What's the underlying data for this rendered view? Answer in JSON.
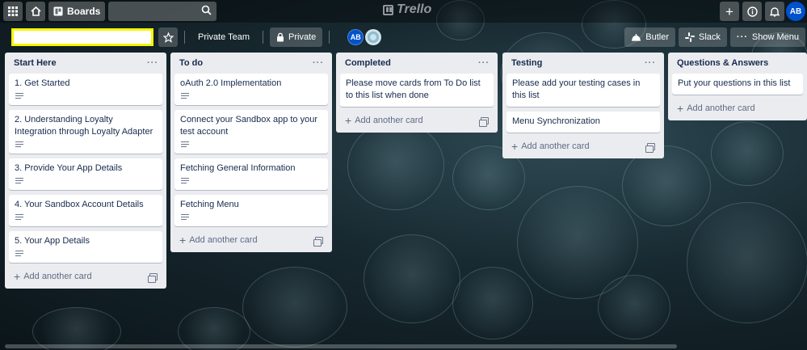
{
  "topbar": {
    "boards_label": "Boards",
    "logo_text": "Trello",
    "avatar_initials": "AB"
  },
  "board": {
    "name": "",
    "team_label": "Private Team",
    "visibility_label": "Private",
    "member_initials": "AB",
    "butler_label": "Butler",
    "slack_label": "Slack",
    "show_menu_label": "Show Menu"
  },
  "add_card_label": "Add another card",
  "lists": [
    {
      "title": "Start Here",
      "cards": [
        {
          "title": "1. Get Started",
          "has_description": true
        },
        {
          "title": "2. Understanding Loyalty Integration through Loyalty Adapter",
          "has_description": true
        },
        {
          "title": "3. Provide Your App Details",
          "has_description": true
        },
        {
          "title": "4. Your Sandbox Account Details",
          "has_description": true
        },
        {
          "title": "5. Your App Details",
          "has_description": true
        }
      ]
    },
    {
      "title": "To do",
      "cards": [
        {
          "title": "oAuth 2.0 Implementation",
          "has_description": true
        },
        {
          "title": "Connect your Sandbox app to your test account",
          "has_description": true
        },
        {
          "title": "Fetching General Information",
          "has_description": true
        },
        {
          "title": "Fetching Menu",
          "has_description": true
        }
      ]
    },
    {
      "title": "Completed",
      "cards": [
        {
          "title": "Please move cards from To Do list to this list when done",
          "has_description": false
        }
      ]
    },
    {
      "title": "Testing",
      "cards": [
        {
          "title": "Please add your testing cases in this list",
          "has_description": false
        },
        {
          "title": "Menu Synchronization",
          "has_description": false
        }
      ]
    },
    {
      "title": "Questions & Answers",
      "cards": [
        {
          "title": "Put your questions in this list",
          "has_description": false
        }
      ]
    }
  ]
}
